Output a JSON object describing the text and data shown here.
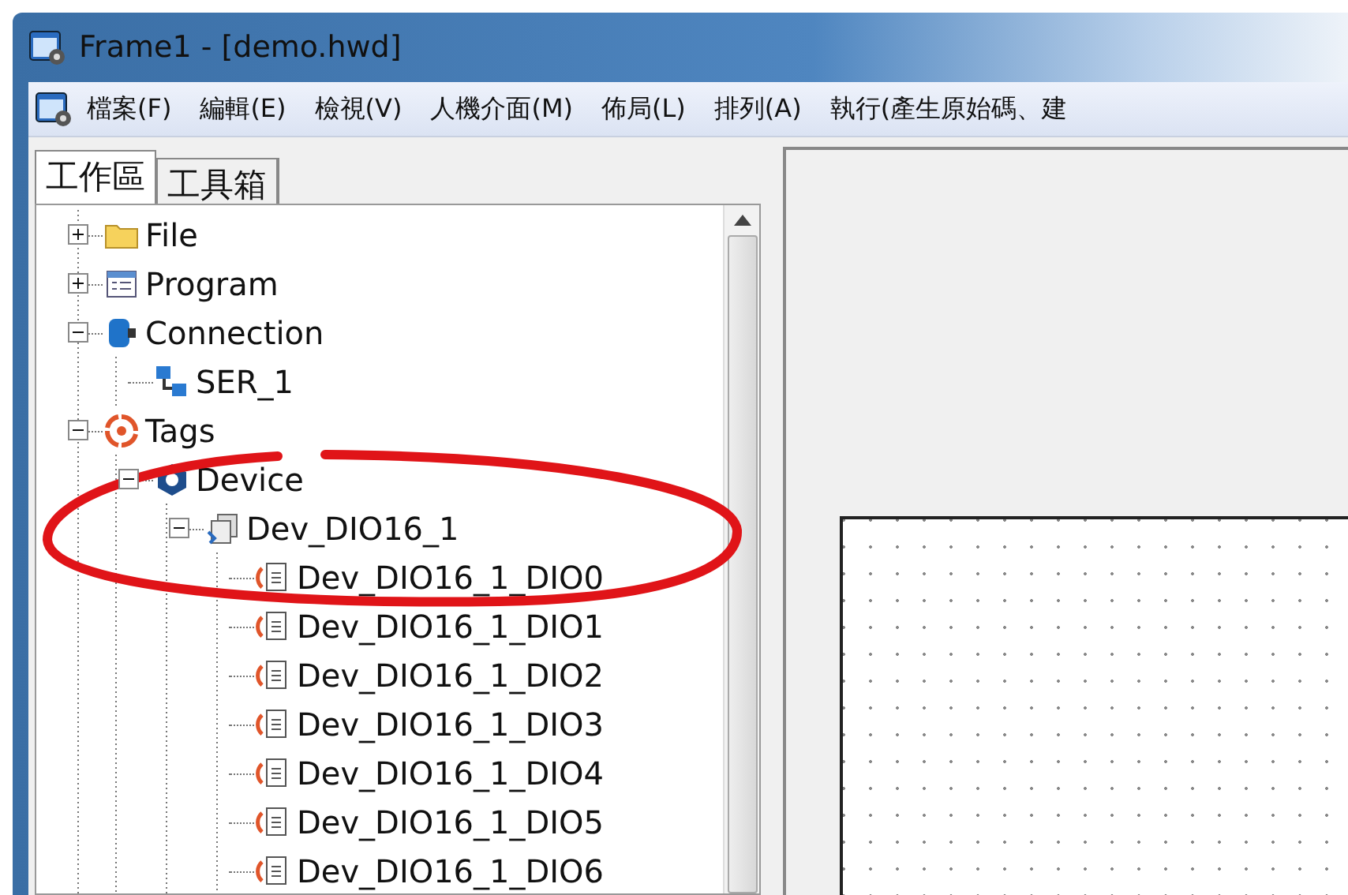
{
  "window": {
    "title": "Frame1 - [demo.hwd]"
  },
  "menu": [
    "檔案(F)",
    "編輯(E)",
    "檢視(V)",
    "人機介面(M)",
    "佈局(L)",
    "排列(A)",
    "執行(產生原始碼、建"
  ],
  "tabs": [
    {
      "label": "工作區",
      "selected": true
    },
    {
      "label": "工具箱",
      "selected": false
    }
  ],
  "tree": [
    {
      "label": "File",
      "kind": "folder",
      "expanded": false
    },
    {
      "label": "Program",
      "kind": "program",
      "expanded": false
    },
    {
      "label": "Connection",
      "kind": "connection",
      "expanded": true,
      "children": [
        {
          "label": "SER_1",
          "kind": "port"
        }
      ]
    },
    {
      "label": "Tags",
      "kind": "tags",
      "expanded": true,
      "children": [
        {
          "label": "Device",
          "kind": "device",
          "expanded": true,
          "children": [
            {
              "label": "Dev_DIO16_1",
              "kind": "module",
              "expanded": true,
              "children": [
                {
                  "label": "Dev_DIO16_1_DIO0",
                  "kind": "tag"
                },
                {
                  "label": "Dev_DIO16_1_DIO1",
                  "kind": "tag"
                },
                {
                  "label": "Dev_DIO16_1_DIO2",
                  "kind": "tag"
                },
                {
                  "label": "Dev_DIO16_1_DIO3",
                  "kind": "tag"
                },
                {
                  "label": "Dev_DIO16_1_DIO4",
                  "kind": "tag"
                },
                {
                  "label": "Dev_DIO16_1_DIO5",
                  "kind": "tag"
                },
                {
                  "label": "Dev_DIO16_1_DIO6",
                  "kind": "tag"
                }
              ]
            }
          ]
        }
      ]
    }
  ]
}
